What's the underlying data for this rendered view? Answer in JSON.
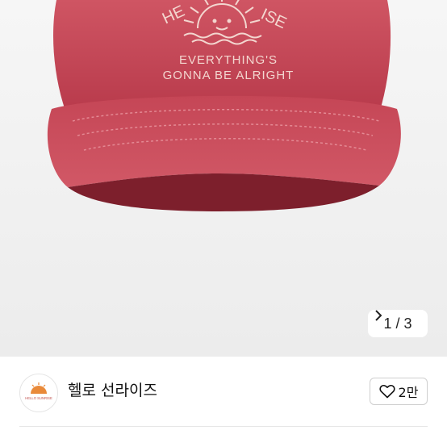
{
  "product_image": {
    "embroidery_arc_left": "HE",
    "embroidery_arc_right": "ISE",
    "embroidery_line1": "EVERYTHING'S",
    "embroidery_line2": "GONNA BE ALRIGHT",
    "cap_color": "#c84a58"
  },
  "pager": {
    "text": "1 / 3"
  },
  "brand": {
    "name": "헬로 선라이즈",
    "logo_text": "HELLO SUNRISE"
  },
  "like": {
    "count": "2만"
  },
  "colors": {
    "accent_sun": "#e98a3a",
    "like_border": "#cfcfcf"
  }
}
